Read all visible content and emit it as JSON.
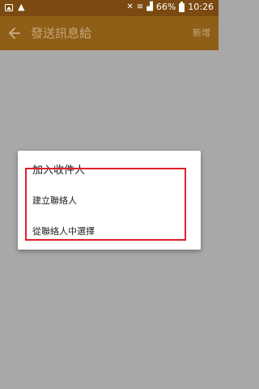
{
  "status_bar": {
    "battery_percent": "66%",
    "time": "10:26",
    "icons": [
      "gallery-icon",
      "warning-icon",
      "mute-icon",
      "wifi-icon",
      "signal-icon",
      "battery-icon"
    ]
  },
  "app_bar": {
    "title": "發送訊息給",
    "action_label": "新增",
    "back_icon": "back-arrow-icon",
    "accent_color": "#8f5e17"
  },
  "dialog": {
    "title": "加入收件人",
    "options": [
      {
        "label": "建立聯絡人"
      },
      {
        "label": "從聯絡人中選擇"
      }
    ],
    "highlight_color": "#e0202a"
  }
}
